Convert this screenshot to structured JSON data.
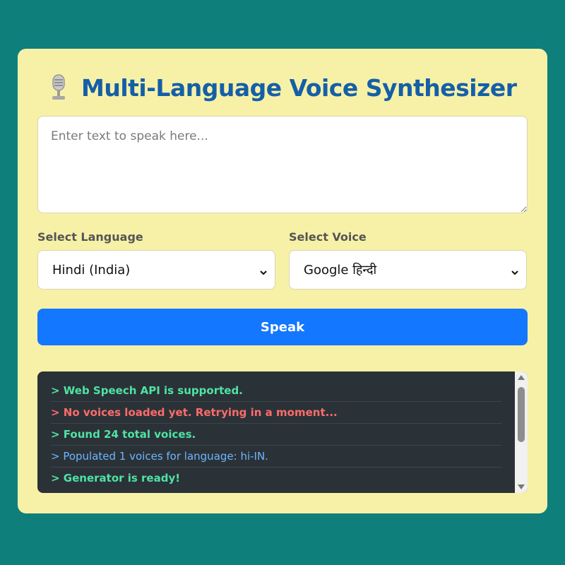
{
  "header": {
    "title": "Multi-Language Voice Synthesizer",
    "icon": "microphone-icon"
  },
  "text_input": {
    "placeholder": "Enter text to speak here...",
    "value": ""
  },
  "language": {
    "label": "Select Language",
    "selected": "Hindi (India)"
  },
  "voice": {
    "label": "Select Voice",
    "selected": "Google हिन्दी"
  },
  "speak_button": {
    "label": "Speak"
  },
  "log": {
    "lines": [
      {
        "text": "> Web Speech API is supported.",
        "color": "#4ee3a4",
        "bold": true
      },
      {
        "text": "> No voices loaded yet. Retrying in a moment...",
        "color": "#ff6b6b",
        "bold": true
      },
      {
        "text": "> Found 24 total voices.",
        "color": "#4ee3a4",
        "bold": true
      },
      {
        "text": "> Populated 1 voices for language: hi-IN.",
        "color": "#6fb4ff",
        "bold": false
      },
      {
        "text": "> Generator is ready!",
        "color": "#4ee3a4",
        "bold": true
      }
    ]
  },
  "colors": {
    "background": "#0f7f7c",
    "card": "#f7f1a8",
    "title": "#155fa8",
    "button": "#1377ff",
    "log_bg": "#2b3237"
  }
}
